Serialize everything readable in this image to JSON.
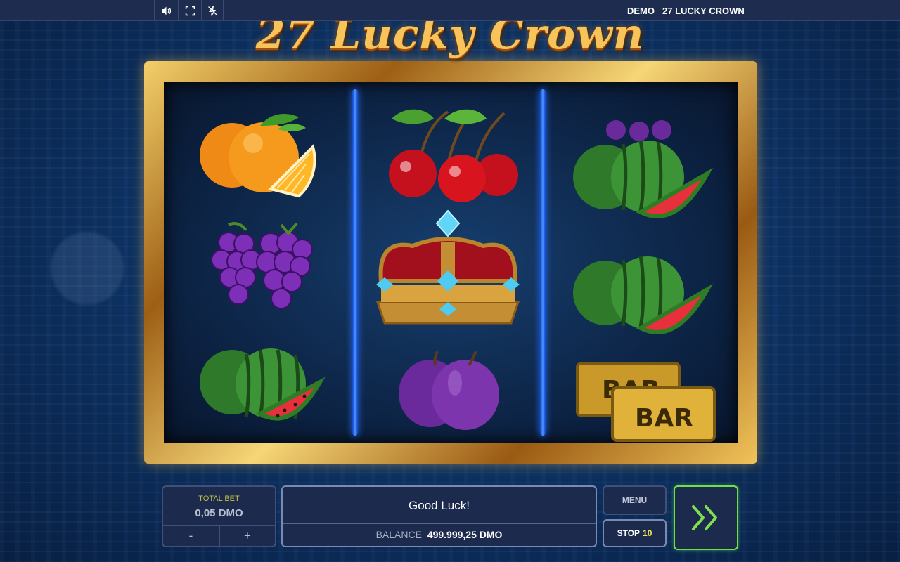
{
  "topbar": {
    "mode_label": "DEMO",
    "game_label": "27 LUCKY CROWN",
    "icons": [
      "sound-icon",
      "fullscreen-icon",
      "turbo-off-icon"
    ]
  },
  "game": {
    "title": "27 Lucky Crown"
  },
  "reels": [
    [
      "orange",
      "grapes",
      "watermelon"
    ],
    [
      "cherries",
      "crown",
      "plum"
    ],
    [
      "watermelon",
      "watermelon",
      "bar"
    ]
  ],
  "bar_symbol_text": "BAR",
  "controls": {
    "total_bet_label": "TOTAL BET",
    "total_bet_value": "0,05 DMO",
    "minus_label": "-",
    "plus_label": "+",
    "message": "Good Luck!",
    "balance_label": "BALANCE",
    "balance_value": "499.999,25 DMO",
    "menu_label": "MENU",
    "stop_label": "STOP",
    "stop_count": "10",
    "spin_icon": "double-chevron-right-icon"
  },
  "colors": {
    "spin_border": "#6fe04a",
    "stop_count": "#f5e15a",
    "total_bet_label": "#c6c24a",
    "divider": "#2b6dff"
  }
}
